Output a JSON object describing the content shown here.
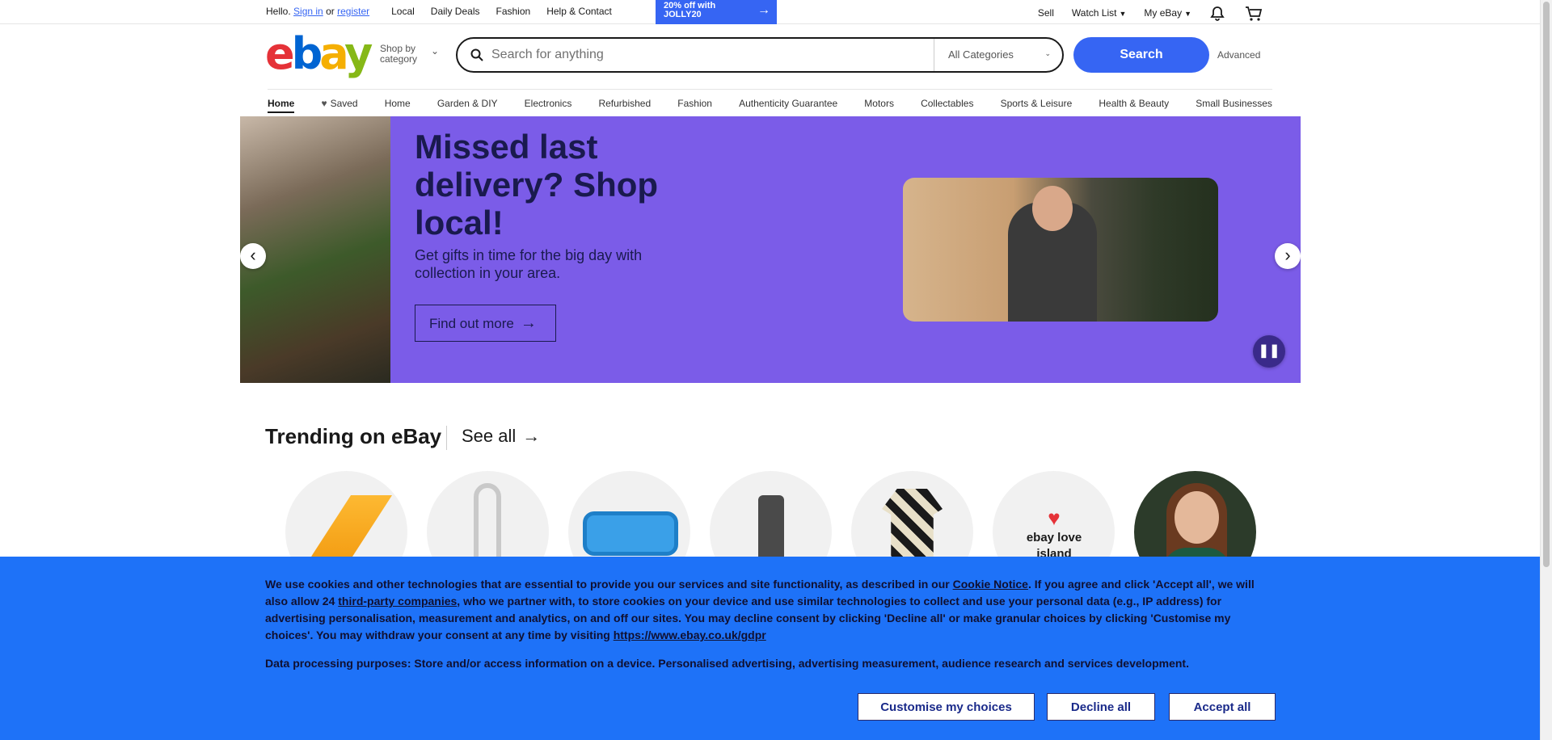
{
  "topbar": {
    "greeting": "Hello.",
    "sign_in": "Sign in",
    "or": "or",
    "register": "register",
    "nav": [
      "Local",
      "Daily Deals",
      "Fashion",
      "Help & Contact"
    ],
    "promo": "20% off with JOLLY20",
    "right": {
      "sell": "Sell",
      "watch_list": "Watch List",
      "my_ebay": "My eBay"
    }
  },
  "header": {
    "logo_letters": [
      "e",
      "b",
      "a",
      "y"
    ],
    "shop_by": "Shop by category",
    "search_placeholder": "Search for anything",
    "category": "All Categories",
    "search_button": "Search",
    "advanced": "Advanced"
  },
  "catnav": {
    "items": [
      "Home",
      "Saved",
      "Home",
      "Garden & DIY",
      "Electronics",
      "Refurbished",
      "Fashion",
      "Authenticity Guarantee",
      "Motors",
      "Collectables",
      "Sports & Leisure",
      "Health & Beauty",
      "Small Businesses"
    ]
  },
  "hero": {
    "headline": "Missed last delivery? Shop local!",
    "sub": "Get gifts in time for the big day with collection in your area.",
    "cta": "Find out more",
    "bg_color": "#7b5ce8"
  },
  "trending": {
    "title": "Trending on eBay",
    "see_all": "See all",
    "items": [
      "deck-chair",
      "fan",
      "paddling-pool",
      "speaker",
      "shirt",
      "love-island",
      "portrait"
    ],
    "love_island_text": "ebay love island"
  },
  "cookie": {
    "p1": "We use cookies and other technologies that are essential to provide you our services and site functionality, as described in our",
    "cookie_notice": "Cookie Notice",
    "p2": ". If you agree and click 'Accept all', we will also allow 24",
    "third_party": "third-party companies",
    "p3": ", who we partner with, to store cookies on your device and use similar technologies to collect and use your personal data (e.g., IP address) for advertising personalisation, measurement and analytics, on and off our sites. You may decline consent by clicking 'Decline all' or make granular choices by clicking 'Customise my choices'. You may withdraw your consent at any time by visiting",
    "gdpr_link": "https://www.ebay.co.uk/gdpr",
    "purposes": "Data processing purposes: Store and/or access information on a device. Personalised advertising, advertising measurement, audience research and services development.",
    "customise": "Customise my choices",
    "decline": "Decline all",
    "accept": "Accept all",
    "bg_color": "#1e72f8"
  }
}
